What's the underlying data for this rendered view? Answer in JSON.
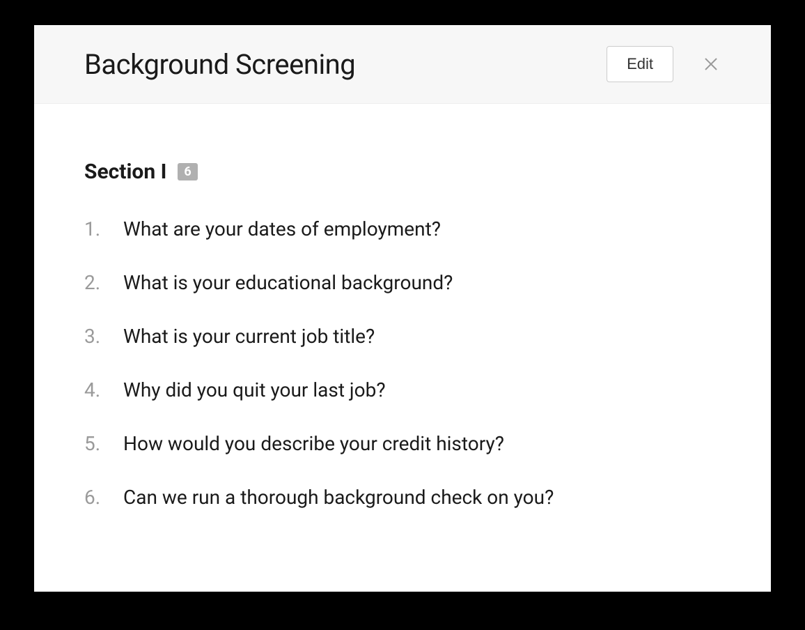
{
  "modal": {
    "title": "Background Screening",
    "edit_label": "Edit"
  },
  "section": {
    "label": "Section I",
    "count": "6",
    "questions": [
      {
        "num": "1.",
        "text": "What are your dates of employment?"
      },
      {
        "num": "2.",
        "text": "What is your educational background?"
      },
      {
        "num": "3.",
        "text": "What is your current job title?"
      },
      {
        "num": "4.",
        "text": "Why did you quit your last job?"
      },
      {
        "num": "5.",
        "text": "How would you describe your credit history?"
      },
      {
        "num": "6.",
        "text": "Can we run a thorough background check on you?"
      }
    ]
  }
}
